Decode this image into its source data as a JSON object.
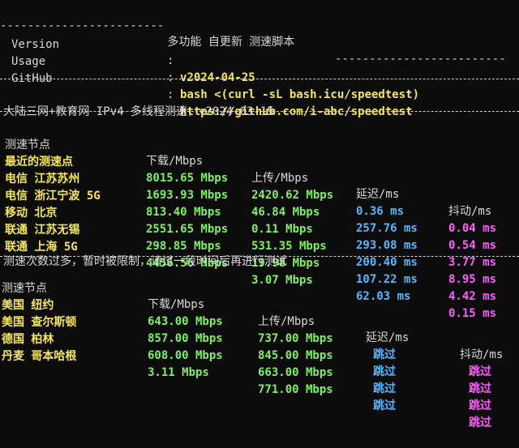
{
  "banner": {
    "title": " 多功能 自更新 测速脚本 ",
    "rows": [
      {
        "key": "Version",
        "colon": ":",
        "value": "v2024-04-25"
      },
      {
        "key": "Usage",
        "colon": ":",
        "value": "bash <(curl -sL bash.icu/speedtest)"
      },
      {
        "key": "GitHub",
        "colon": ":",
        "value": "https://github.com/i-abc/speedtest"
      }
    ]
  },
  "section_title": "大陆三网+教育网 IPv4 多线程测速，v2024-03-15",
  "table1": {
    "headers": [
      "测速节点",
      "下载/Mbps",
      "上传/Mbps",
      "延迟/ms",
      "抖动/ms"
    ],
    "rows": [
      [
        "最近的测速点",
        "8015.65 Mbps",
        "2420.62 Mbps",
        "0.36 ms",
        "0.04 ms"
      ],
      [
        "电信 江苏苏州",
        "1693.93 Mbps",
        "46.84 Mbps",
        "257.76 ms",
        "0.54 ms"
      ],
      [
        "电信 浙江宁波 5G",
        "813.40 Mbps",
        "0.11 Mbps",
        "293.08 ms",
        "3.77 ms"
      ],
      [
        "移动 北京",
        "2551.65 Mbps",
        "531.35 Mbps",
        "200.40 ms",
        "8.95 ms"
      ],
      [
        "联通 江苏无锡",
        "298.85 Mbps",
        "19.98 Mbps",
        "107.22 ms",
        "4.42 ms"
      ],
      [
        "联通 上海 5G",
        "4456.56 Mbps",
        "3.07 Mbps",
        "62.03 ms",
        "0.15 ms"
      ]
    ],
    "note": "测速次数过多，暂时被限制，请过一段时间后再进行测试"
  },
  "table2": {
    "headers": [
      "测速节点",
      "下载/Mbps",
      "上传/Mbps",
      "延迟/ms",
      "抖动/ms"
    ],
    "rows": [
      [
        "美国 纽约",
        "643.00 Mbps",
        "737.00 Mbps",
        "跳过",
        "跳过"
      ],
      [
        "美国 查尔斯顿",
        "857.00 Mbps",
        "845.00 Mbps",
        "跳过",
        "跳过"
      ],
      [
        "德国 柏林",
        "608.00 Mbps",
        "663.00 Mbps",
        "跳过",
        "跳过"
      ],
      [
        "丹麦 哥本哈根",
        "3.11 Mbps",
        "771.00 Mbps",
        "跳过",
        "跳过"
      ]
    ]
  },
  "colors": {
    "background": "#0c0c0c",
    "node": "#f5e65a",
    "download": "#7ef061",
    "upload": "#7ef061",
    "latency": "#57b7ff",
    "jitter": "#ff5cff",
    "banner_value": "#f5e65a"
  }
}
